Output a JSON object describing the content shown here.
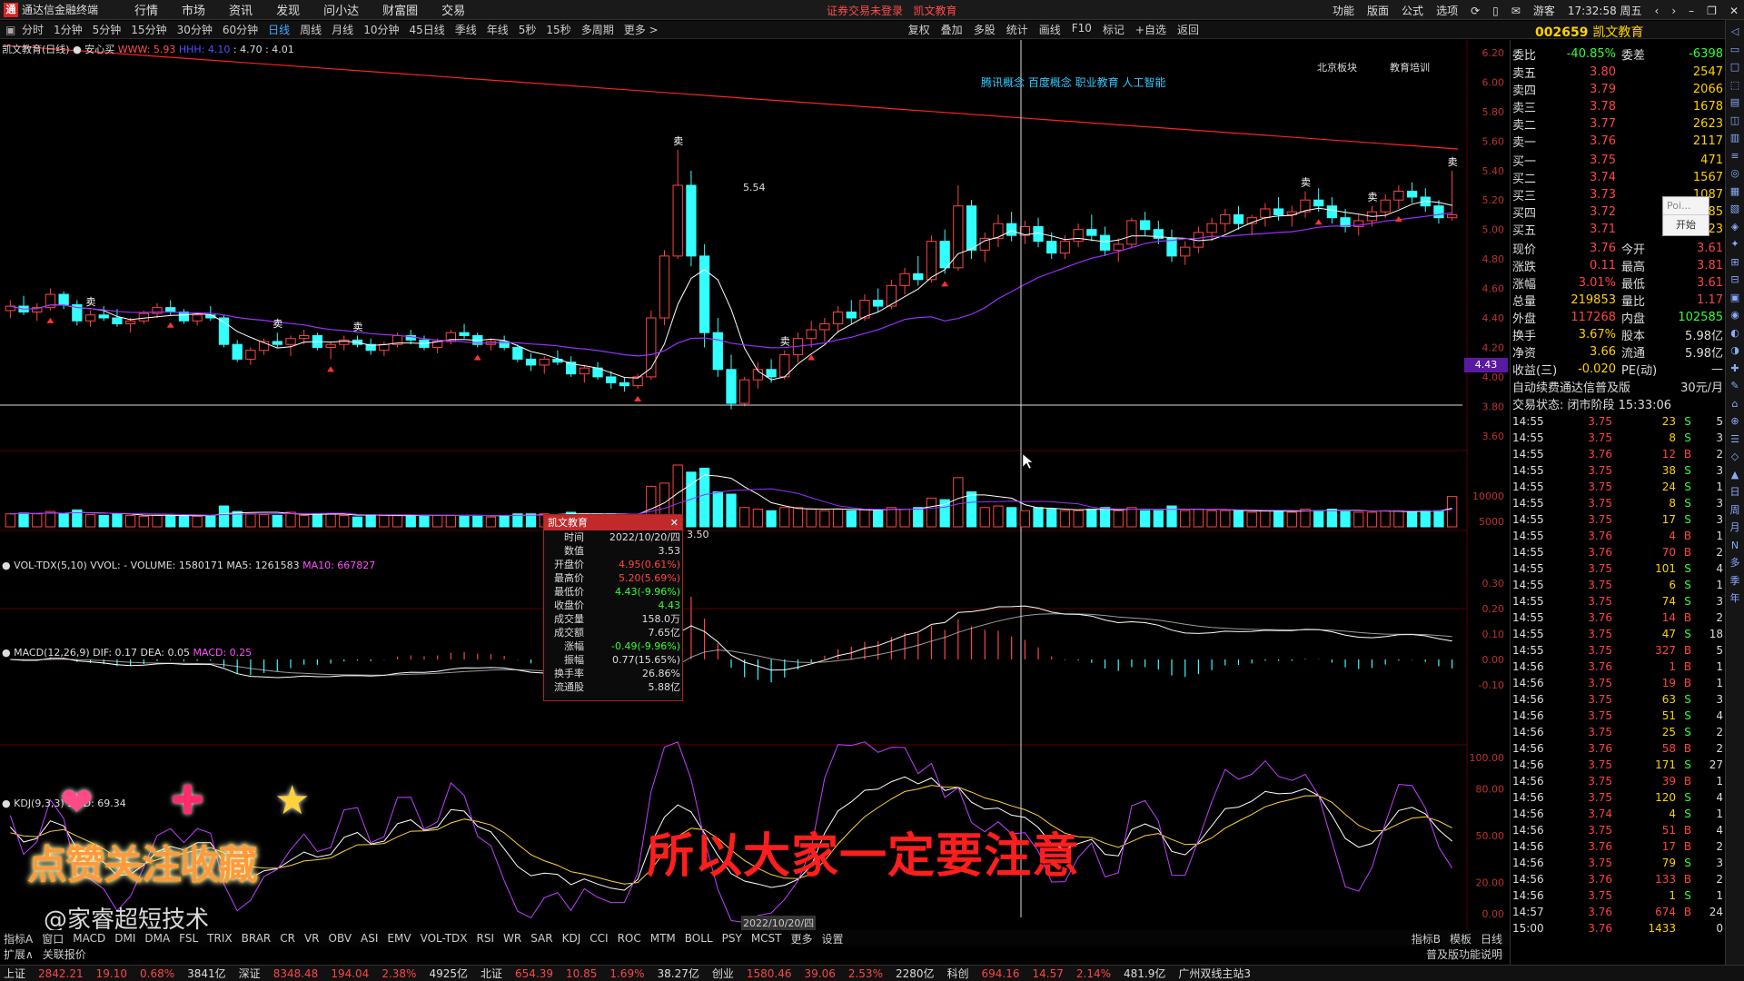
{
  "titlebar": {
    "app_title": "通达信金融终端",
    "menu": [
      "行情",
      "市场",
      "资讯",
      "发现",
      "问小达",
      "财富圈",
      "交易"
    ],
    "center_notice": "证券交易未登录",
    "center_name": "凯文教育",
    "right_items": [
      "功能",
      "版面",
      "公式",
      "选项",
      "游客"
    ],
    "clock": "17:32:58 周五"
  },
  "toolbar": {
    "periods": [
      "分时",
      "1分钟",
      "5分钟",
      "15分钟",
      "30分钟",
      "60分钟",
      "日线",
      "周线",
      "月线",
      "10分钟",
      "45日线",
      "季线",
      "年线",
      "5秒",
      "15秒",
      "多周期",
      "更多 >"
    ],
    "active_period": "日线",
    "tools": [
      "复权",
      "叠加",
      "多股",
      "统计",
      "画线",
      "F10",
      "标记",
      "+自选",
      "返回"
    ]
  },
  "stock": {
    "code": "002659",
    "name": "凯文教育"
  },
  "main_panel": {
    "label_name": "凯文教育(日线)",
    "label_indicator": "安心买",
    "label_v1": "WWW: 5.93",
    "label_v2": "HHH: 4.10",
    "label_v3": ": 4.70 : 4.01",
    "concepts": "腾讯概念 百度概念 职业教育 人工智能",
    "tag1": "北京板块",
    "tag2": "教育培训",
    "high_label": "5.54",
    "cross_label": "3.50",
    "cross_price": "4.43",
    "axis_ticks": [
      "6.20",
      "6.00",
      "5.80",
      "5.60",
      "5.40",
      "5.20",
      "5.00",
      "4.80",
      "4.60",
      "4.40",
      "4.20",
      "4.00",
      "3.80",
      "3.60"
    ],
    "sell_marker": "卖"
  },
  "vol_panel": {
    "label": "VOL-TDX(5,10)",
    "v1": "VVOL: - VOLUME: 1580171",
    "v2": "MA5: 1261583",
    "v3": "MA10: 667827",
    "axis_ticks": [
      "10000",
      "5000"
    ]
  },
  "macd_panel": {
    "label": "MACD(12,26,9)",
    "v1": "DIF: 0.17",
    "v2": "DEA: 0.05",
    "v3": "MACD: 0.25",
    "axis_ticks": [
      "0.30",
      "0.20",
      "0.10",
      "0.00",
      "-0.10"
    ]
  },
  "kdj_panel": {
    "label": "KDJ(9,3,3)",
    "v1": "50 D: 69.34",
    "axis_ticks": [
      "100.00",
      "80.00",
      "50.00",
      "20.00",
      "0.00"
    ]
  },
  "tooltip": {
    "title": "凯文教育",
    "rows": [
      {
        "k": "时间",
        "v": "2022/10/20/四",
        "c": "white"
      },
      {
        "k": "数值",
        "v": "3.53",
        "c": "white"
      },
      {
        "k": "开盘价",
        "v": "4.95(0.61%)",
        "c": "red"
      },
      {
        "k": "最高价",
        "v": "5.20(5.69%)",
        "c": "red"
      },
      {
        "k": "最低价",
        "v": "4.43(-9.96%)",
        "c": "green"
      },
      {
        "k": "收盘价",
        "v": "4.43",
        "c": "green"
      },
      {
        "k": "成交量",
        "v": "158.0万",
        "c": "white"
      },
      {
        "k": "成交额",
        "v": "7.65亿",
        "c": "white"
      },
      {
        "k": "涨幅",
        "v": "-0.49(-9.96%)",
        "c": "green"
      },
      {
        "k": "振幅",
        "v": "0.77(15.65%)",
        "c": "white"
      },
      {
        "k": "换手率",
        "v": "26.86%",
        "c": "white"
      },
      {
        "k": "流通股",
        "v": "5.88亿",
        "c": "white"
      }
    ]
  },
  "date_marker": "2022/10/20/四",
  "overlay_caption": "所以大家一定要注意",
  "watermark": "@家睿超短技术",
  "like_text": "点赞关注收藏",
  "bottom_tabs": [
    "指标A",
    "窗口",
    "MACD",
    "DMI",
    "DMA",
    "FSL",
    "TRIX",
    "BRAR",
    "CR",
    "VR",
    "OBV",
    "ASI",
    "EMV",
    "VOL-TDX",
    "RSI",
    "WR",
    "SAR",
    "KDJ",
    "CCI",
    "ROC",
    "MTM",
    "BOLL",
    "PSY",
    "MCST",
    "更多",
    "设置"
  ],
  "bottom_tabs_right": [
    "指标B",
    "模板",
    "日线"
  ],
  "bottom_tabs2": [
    "扩展∧",
    "关联报价"
  ],
  "bottom_tabs2_right": "普及版功能说明",
  "statusbar": [
    {
      "t": "上证",
      "c": "w"
    },
    {
      "t": "2842.21",
      "c": "up"
    },
    {
      "t": "19.10",
      "c": "up"
    },
    {
      "t": "0.68%",
      "c": "up"
    },
    {
      "t": "3841亿",
      "c": "w"
    },
    {
      "t": "深证",
      "c": "w"
    },
    {
      "t": "8348.48",
      "c": "up"
    },
    {
      "t": "194.04",
      "c": "up"
    },
    {
      "t": "2.38%",
      "c": "up"
    },
    {
      "t": "4925亿",
      "c": "w"
    },
    {
      "t": "北证",
      "c": "w"
    },
    {
      "t": "654.39",
      "c": "up"
    },
    {
      "t": "10.85",
      "c": "up"
    },
    {
      "t": "1.69%",
      "c": "up"
    },
    {
      "t": "38.27亿",
      "c": "w"
    },
    {
      "t": "创业",
      "c": "w"
    },
    {
      "t": "1580.46",
      "c": "up"
    },
    {
      "t": "39.06",
      "c": "up"
    },
    {
      "t": "2.53%",
      "c": "up"
    },
    {
      "t": "2280亿",
      "c": "w"
    },
    {
      "t": "科创",
      "c": "w"
    },
    {
      "t": "694.16",
      "c": "up"
    },
    {
      "t": "14.57",
      "c": "up"
    },
    {
      "t": "2.14%",
      "c": "up"
    },
    {
      "t": "481.9亿",
      "c": "w"
    },
    {
      "t": "广州双线主站3",
      "c": "w"
    }
  ],
  "quote": {
    "weibi_label": "委比",
    "weibi": "-40.85%",
    "weicha_label": "委差",
    "weicha": "-6398",
    "asks": [
      {
        "label": "卖五",
        "price": "3.80",
        "vol": "2547"
      },
      {
        "label": "卖四",
        "price": "3.79",
        "vol": "2066"
      },
      {
        "label": "卖三",
        "price": "3.78",
        "vol": "1678"
      },
      {
        "label": "卖二",
        "price": "3.77",
        "vol": "2623"
      },
      {
        "label": "卖一",
        "price": "3.76",
        "vol": "2117"
      }
    ],
    "bids": [
      {
        "label": "买一",
        "price": "3.75",
        "vol": "471"
      },
      {
        "label": "买二",
        "price": "3.74",
        "vol": "1567"
      },
      {
        "label": "买三",
        "price": "3.73",
        "vol": "1087"
      },
      {
        "label": "买四",
        "price": "3.72",
        "vol": "85"
      },
      {
        "label": "买五",
        "price": "3.71",
        "vol": "23"
      }
    ],
    "stats": [
      {
        "l1": "现价",
        "v1": "3.76",
        "c1": "red",
        "l2": "今开",
        "v2": "3.61",
        "c2": "red"
      },
      {
        "l1": "涨跌",
        "v1": "0.11",
        "c1": "red",
        "l2": "最高",
        "v2": "3.81",
        "c2": "red"
      },
      {
        "l1": "涨幅",
        "v1": "3.01%",
        "c1": "red",
        "l2": "最低",
        "v2": "3.61",
        "c2": "red"
      },
      {
        "l1": "总量",
        "v1": "219853",
        "c1": "yellow",
        "l2": "量比",
        "v2": "1.17",
        "c2": "red"
      },
      {
        "l1": "外盘",
        "v1": "117268",
        "c1": "red",
        "l2": "内盘",
        "v2": "102585",
        "c2": "green"
      },
      {
        "l1": "换手",
        "v1": "3.67%",
        "c1": "yellow",
        "l2": "股本",
        "v2": "5.98亿",
        "c2": "white"
      },
      {
        "l1": "净资",
        "v1": "3.66",
        "c1": "yellow",
        "l2": "流通",
        "v2": "5.98亿",
        "c2": "white"
      },
      {
        "l1": "收益(三)",
        "v1": "-0.020",
        "c1": "yellow",
        "l2": "PE(动)",
        "v2": "—",
        "c2": "white"
      }
    ],
    "promo": "自动续费通达信普及版",
    "promo_price": "30元/月",
    "trade_status": "交易状态: 闭市阶段 15:33:06"
  },
  "ticks": [
    {
      "t": "14:55",
      "p": "3.75",
      "q": "23",
      "bs": "S",
      "n": "5"
    },
    {
      "t": "14:55",
      "p": "3.75",
      "q": "8",
      "bs": "S",
      "n": "3"
    },
    {
      "t": "14:55",
      "p": "3.76",
      "q": "12",
      "bs": "B",
      "n": "2"
    },
    {
      "t": "14:55",
      "p": "3.75",
      "q": "38",
      "bs": "S",
      "n": "3"
    },
    {
      "t": "14:55",
      "p": "3.75",
      "q": "24",
      "bs": "S",
      "n": "1"
    },
    {
      "t": "14:55",
      "p": "3.75",
      "q": "8",
      "bs": "S",
      "n": "3"
    },
    {
      "t": "14:55",
      "p": "3.75",
      "q": "17",
      "bs": "S",
      "n": "3"
    },
    {
      "t": "14:55",
      "p": "3.76",
      "q": "4",
      "bs": "B",
      "n": "1"
    },
    {
      "t": "14:55",
      "p": "3.76",
      "q": "70",
      "bs": "B",
      "n": "2"
    },
    {
      "t": "14:55",
      "p": "3.75",
      "q": "101",
      "bs": "S",
      "n": "4"
    },
    {
      "t": "14:55",
      "p": "3.75",
      "q": "6",
      "bs": "S",
      "n": "1"
    },
    {
      "t": "14:55",
      "p": "3.75",
      "q": "74",
      "bs": "S",
      "n": "3"
    },
    {
      "t": "14:55",
      "p": "3.76",
      "q": "14",
      "bs": "B",
      "n": "2"
    },
    {
      "t": "14:55",
      "p": "3.75",
      "q": "47",
      "bs": "S",
      "n": "18"
    },
    {
      "t": "14:55",
      "p": "3.75",
      "q": "327",
      "bs": "B",
      "n": "5"
    },
    {
      "t": "14:56",
      "p": "3.76",
      "q": "1",
      "bs": "B",
      "n": "1"
    },
    {
      "t": "14:56",
      "p": "3.75",
      "q": "19",
      "bs": "B",
      "n": "1"
    },
    {
      "t": "14:56",
      "p": "3.75",
      "q": "63",
      "bs": "S",
      "n": "3"
    },
    {
      "t": "14:56",
      "p": "3.75",
      "q": "51",
      "bs": "S",
      "n": "4"
    },
    {
      "t": "14:56",
      "p": "3.75",
      "q": "25",
      "bs": "S",
      "n": "2"
    },
    {
      "t": "14:56",
      "p": "3.76",
      "q": "58",
      "bs": "B",
      "n": "2"
    },
    {
      "t": "14:56",
      "p": "3.75",
      "q": "171",
      "bs": "S",
      "n": "27"
    },
    {
      "t": "14:56",
      "p": "3.75",
      "q": "39",
      "bs": "B",
      "n": "1"
    },
    {
      "t": "14:56",
      "p": "3.75",
      "q": "120",
      "bs": "S",
      "n": "4"
    },
    {
      "t": "14:56",
      "p": "3.74",
      "q": "4",
      "bs": "S",
      "n": "1"
    },
    {
      "t": "14:56",
      "p": "3.75",
      "q": "51",
      "bs": "B",
      "n": "4"
    },
    {
      "t": "14:56",
      "p": "3.76",
      "q": "17",
      "bs": "B",
      "n": "2"
    },
    {
      "t": "14:56",
      "p": "3.75",
      "q": "79",
      "bs": "S",
      "n": "3"
    },
    {
      "t": "14:56",
      "p": "3.76",
      "q": "133",
      "bs": "B",
      "n": "2"
    },
    {
      "t": "14:56",
      "p": "3.75",
      "q": "1",
      "bs": "S",
      "n": "1"
    },
    {
      "t": "14:57",
      "p": "3.76",
      "q": "674",
      "bs": "B",
      "n": "24"
    },
    {
      "t": "15:00",
      "p": "3.76",
      "q": "1433",
      "bs": "",
      "n": "0"
    }
  ],
  "popup": {
    "input_placeholder": "Poi...",
    "button": "开始"
  },
  "colors": {
    "up": "#ff4444",
    "down": "#33ffff",
    "ma1": "#ffffff",
    "ma2": "#9b30ff",
    "trend": "#ff2222",
    "crosshair": "#ffffff"
  },
  "chart_data": {
    "type": "candlestick",
    "price_range": [
      3.5,
      6.2
    ],
    "candles": [
      [
        4.45,
        4.52,
        4.4,
        4.48
      ],
      [
        4.48,
        4.55,
        4.42,
        4.44
      ],
      [
        4.44,
        4.5,
        4.38,
        4.47
      ],
      [
        4.47,
        4.6,
        4.45,
        4.56
      ],
      [
        4.56,
        4.58,
        4.46,
        4.49
      ],
      [
        4.49,
        4.52,
        4.35,
        4.38
      ],
      [
        4.38,
        4.45,
        4.34,
        4.42
      ],
      [
        4.42,
        4.48,
        4.38,
        4.4
      ],
      [
        4.4,
        4.46,
        4.34,
        4.36
      ],
      [
        4.36,
        4.4,
        4.3,
        4.38
      ],
      [
        4.38,
        4.45,
        4.36,
        4.43
      ],
      [
        4.43,
        4.5,
        4.4,
        4.47
      ],
      [
        4.47,
        4.52,
        4.42,
        4.44
      ],
      [
        4.44,
        4.46,
        4.36,
        4.38
      ],
      [
        4.38,
        4.44,
        4.35,
        4.42
      ],
      [
        4.42,
        4.48,
        4.38,
        4.4
      ],
      [
        4.4,
        4.42,
        4.2,
        4.22
      ],
      [
        4.22,
        4.25,
        4.1,
        4.12
      ],
      [
        4.12,
        4.2,
        4.08,
        4.18
      ],
      [
        4.18,
        4.26,
        4.15,
        4.24
      ],
      [
        4.24,
        4.3,
        4.2,
        4.22
      ],
      [
        4.22,
        4.28,
        4.14,
        4.26
      ],
      [
        4.26,
        4.32,
        4.22,
        4.28
      ],
      [
        4.28,
        4.3,
        4.18,
        4.2
      ],
      [
        4.2,
        4.24,
        4.12,
        4.22
      ],
      [
        4.22,
        4.28,
        4.18,
        4.25
      ],
      [
        4.25,
        4.28,
        4.2,
        4.22
      ],
      [
        4.22,
        4.26,
        4.15,
        4.18
      ],
      [
        4.18,
        4.24,
        4.14,
        4.22
      ],
      [
        4.22,
        4.3,
        4.2,
        4.28
      ],
      [
        4.28,
        4.32,
        4.22,
        4.25
      ],
      [
        4.25,
        4.28,
        4.18,
        4.2
      ],
      [
        4.2,
        4.26,
        4.16,
        4.24
      ],
      [
        4.24,
        4.32,
        4.22,
        4.3
      ],
      [
        4.3,
        4.36,
        4.26,
        4.28
      ],
      [
        4.28,
        4.3,
        4.2,
        4.22
      ],
      [
        4.22,
        4.26,
        4.18,
        4.24
      ],
      [
        4.24,
        4.28,
        4.18,
        4.2
      ],
      [
        4.2,
        4.22,
        4.1,
        4.12
      ],
      [
        4.12,
        4.16,
        4.04,
        4.08
      ],
      [
        4.08,
        4.14,
        4.02,
        4.12
      ],
      [
        4.12,
        4.18,
        4.08,
        4.1
      ],
      [
        4.1,
        4.14,
        4.0,
        4.02
      ],
      [
        4.02,
        4.08,
        3.96,
        4.06
      ],
      [
        4.06,
        4.1,
        3.98,
        4.0
      ],
      [
        4.0,
        4.04,
        3.92,
        3.96
      ],
      [
        3.96,
        4.0,
        3.9,
        3.94
      ],
      [
        3.94,
        4.02,
        3.92,
        4.0
      ],
      [
        4.0,
        4.45,
        3.98,
        4.4
      ],
      [
        4.4,
        4.86,
        4.35,
        4.82
      ],
      [
        4.82,
        5.54,
        4.8,
        5.3
      ],
      [
        5.3,
        5.4,
        4.75,
        4.82
      ],
      [
        4.82,
        4.9,
        4.2,
        4.3
      ],
      [
        4.3,
        4.4,
        4.0,
        4.05
      ],
      [
        4.05,
        4.15,
        3.78,
        3.82
      ],
      [
        3.82,
        4.0,
        3.8,
        3.98
      ],
      [
        3.98,
        4.1,
        3.92,
        4.05
      ],
      [
        4.05,
        4.12,
        3.96,
        4.0
      ],
      [
        4.0,
        4.18,
        3.98,
        4.15
      ],
      [
        4.15,
        4.3,
        4.1,
        4.26
      ],
      [
        4.26,
        4.38,
        4.2,
        4.32
      ],
      [
        4.32,
        4.4,
        4.24,
        4.36
      ],
      [
        4.36,
        4.48,
        4.3,
        4.44
      ],
      [
        4.44,
        4.52,
        4.36,
        4.4
      ],
      [
        4.4,
        4.56,
        4.38,
        4.52
      ],
      [
        4.52,
        4.6,
        4.44,
        4.48
      ],
      [
        4.48,
        4.66,
        4.46,
        4.62
      ],
      [
        4.62,
        4.74,
        4.56,
        4.7
      ],
      [
        4.7,
        4.82,
        4.62,
        4.66
      ],
      [
        4.66,
        4.96,
        4.64,
        4.92
      ],
      [
        4.92,
        5.0,
        4.7,
        4.74
      ],
      [
        4.74,
        5.3,
        4.72,
        5.16
      ],
      [
        5.16,
        5.2,
        4.8,
        4.86
      ],
      [
        4.86,
        4.98,
        4.78,
        4.94
      ],
      [
        4.94,
        5.1,
        4.88,
        5.04
      ],
      [
        5.04,
        5.12,
        4.92,
        4.96
      ],
      [
        4.96,
        5.06,
        4.9,
        5.02
      ],
      [
        5.02,
        5.08,
        4.88,
        4.92
      ],
      [
        4.92,
        4.98,
        4.8,
        4.84
      ],
      [
        4.84,
        4.96,
        4.8,
        4.92
      ],
      [
        4.92,
        5.04,
        4.88,
        5.0
      ],
      [
        5.0,
        5.1,
        4.92,
        4.96
      ],
      [
        4.96,
        5.02,
        4.82,
        4.86
      ],
      [
        4.86,
        4.94,
        4.78,
        4.9
      ],
      [
        4.9,
        5.08,
        4.88,
        5.06
      ],
      [
        5.06,
        5.12,
        4.96,
        5.0
      ],
      [
        5.0,
        5.06,
        4.9,
        4.94
      ],
      [
        4.94,
        5.0,
        4.78,
        4.82
      ],
      [
        4.82,
        4.92,
        4.76,
        4.88
      ],
      [
        4.88,
        5.02,
        4.84,
        4.98
      ],
      [
        4.98,
        5.08,
        4.92,
        5.04
      ],
      [
        5.04,
        5.14,
        4.98,
        5.1
      ],
      [
        5.1,
        5.16,
        5.0,
        5.04
      ],
      [
        5.04,
        5.1,
        4.96,
        5.08
      ],
      [
        5.08,
        5.18,
        5.02,
        5.14
      ],
      [
        5.14,
        5.22,
        5.06,
        5.1
      ],
      [
        5.1,
        5.16,
        5.02,
        5.12
      ],
      [
        5.12,
        5.26,
        5.08,
        5.2
      ],
      [
        5.2,
        5.28,
        5.12,
        5.16
      ],
      [
        5.16,
        5.22,
        5.04,
        5.08
      ],
      [
        5.08,
        5.14,
        4.98,
        5.02
      ],
      [
        5.02,
        5.1,
        4.96,
        5.06
      ],
      [
        5.06,
        5.16,
        5.02,
        5.12
      ],
      [
        5.12,
        5.24,
        5.08,
        5.2
      ],
      [
        5.2,
        5.3,
        5.14,
        5.26
      ],
      [
        5.26,
        5.32,
        5.18,
        5.22
      ],
      [
        5.22,
        5.28,
        5.12,
        5.16
      ],
      [
        5.16,
        5.2,
        5.04,
        5.08
      ],
      [
        5.08,
        5.4,
        5.06,
        5.1
      ]
    ]
  }
}
